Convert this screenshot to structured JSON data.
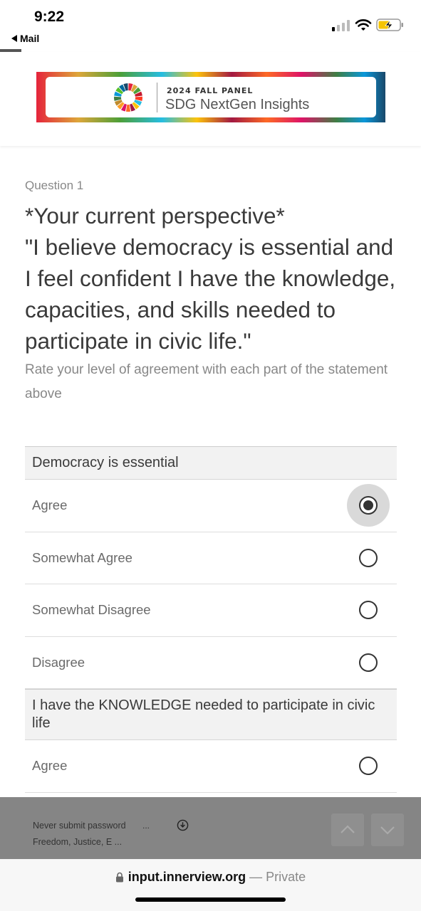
{
  "status_bar": {
    "time": "9:22",
    "back_app": "Mail",
    "icons": [
      "cellular-signal-icon",
      "wifi-icon",
      "battery-charging-icon"
    ]
  },
  "banner": {
    "kicker": "2024 FALL PANEL",
    "title": "SDG NextGen Insights"
  },
  "question": {
    "number": "Question 1",
    "title": "*Your current perspective*\n\"I believe democracy is essential and I feel confident I have the knowledge, capacities, and skills needed to participate in civic life.\"",
    "instructions": "Rate your level of agreement with each part of the statement above"
  },
  "matrix": {
    "groups": [
      {
        "heading": "Democracy is essential",
        "options": [
          {
            "label": "Agree",
            "selected": true
          },
          {
            "label": "Somewhat Agree",
            "selected": false
          },
          {
            "label": "Somewhat Disagree",
            "selected": false
          },
          {
            "label": "Disagree",
            "selected": false
          }
        ]
      },
      {
        "heading": "I have the KNOWLEDGE needed to participate in civic life",
        "options": [
          {
            "label": "Agree",
            "selected": false
          }
        ]
      }
    ]
  },
  "overlay": {
    "line1": "Never submit password",
    "ellipsis": "...",
    "line2": "Freedom, Justice, E ..."
  },
  "urlbar": {
    "domain": "input.innerview.org",
    "separator": "—",
    "mode": "Private"
  },
  "colors": {
    "text": "#3a3a3a",
    "muted": "#888888",
    "group_bg": "#f2f2f2",
    "overlay_bg": "#858585"
  }
}
